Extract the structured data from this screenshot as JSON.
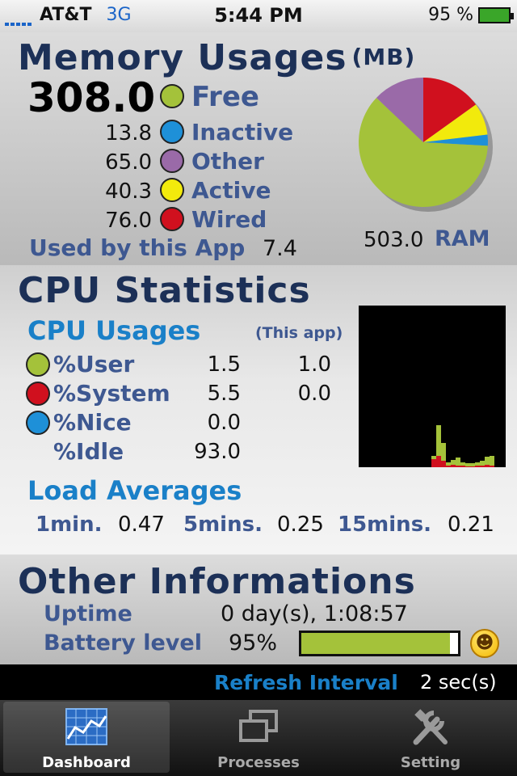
{
  "status_bar": {
    "carrier": "AT&T",
    "network": "3G",
    "time": "5:44 PM",
    "battery": "95 %"
  },
  "memory": {
    "title": "Memory Usages",
    "unit": "(MB)",
    "free_value": "308.0",
    "free_label": "Free",
    "rows": [
      {
        "value": "13.8",
        "label": "Inactive",
        "color": "#1e90d8"
      },
      {
        "value": "65.0",
        "label": "Other",
        "color": "#9a6aa8"
      },
      {
        "value": "40.3",
        "label": "Active",
        "color": "#f2ea0c"
      },
      {
        "value": "76.0",
        "label": "Wired",
        "color": "#d0101e"
      }
    ],
    "free_color": "#a4c23a",
    "used_by_app_label": "Used by this App",
    "used_by_app_value": "7.4",
    "ram_value": "503.0",
    "ram_label": "RAM"
  },
  "cpu": {
    "title": "CPU Statistics",
    "usage_header": "CPU Usages",
    "this_app_header": "(This app)",
    "rows": [
      {
        "label": "%User",
        "value": "1.5",
        "app": "1.0",
        "color": "#a4c23a"
      },
      {
        "label": "%System",
        "value": "5.5",
        "app": "0.0",
        "color": "#d0101e"
      },
      {
        "label": "%Nice",
        "value": "0.0",
        "app": "",
        "color": "#1e90d8"
      },
      {
        "label": "%Idle",
        "value": "93.0",
        "app": "",
        "color": ""
      }
    ],
    "load_title": "Load Averages",
    "load": [
      {
        "label": "1min.",
        "value": "0.47"
      },
      {
        "label": "5mins.",
        "value": "0.25"
      },
      {
        "label": "15mins.",
        "value": "0.21"
      }
    ]
  },
  "other": {
    "title": "Other Informations",
    "uptime_label": "Uptime",
    "uptime_value": "0 day(s), 1:08:57",
    "battery_label": "Battery level",
    "battery_value": "95%",
    "battery_fraction": 0.95
  },
  "refresh": {
    "label": "Refresh Interval",
    "value": "2 sec(s)"
  },
  "tabs": [
    {
      "label": "Dashboard",
      "icon": "chart-icon",
      "active": true
    },
    {
      "label": "Processes",
      "icon": "windows-icon",
      "active": false
    },
    {
      "label": "Setting",
      "icon": "tools-icon",
      "active": false
    }
  ]
}
